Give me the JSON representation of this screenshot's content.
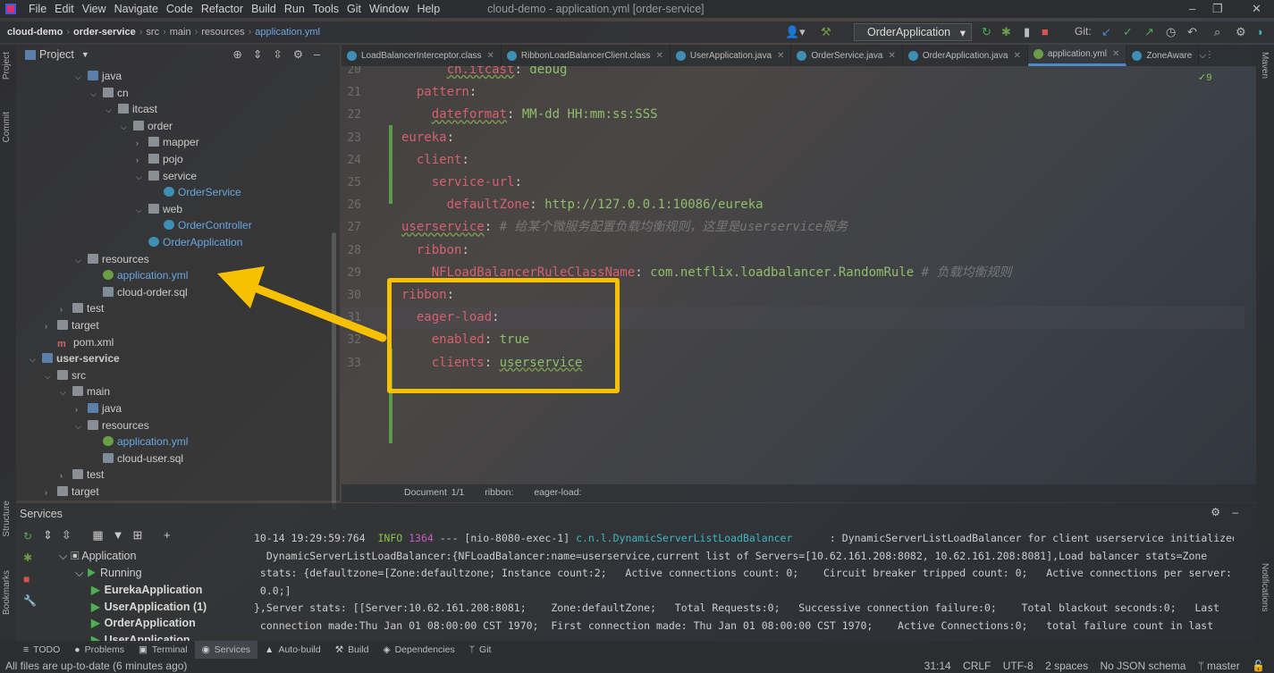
{
  "window": {
    "title": "cloud-demo - application.yml [order-service]",
    "menu": [
      "File",
      "Edit",
      "View",
      "Navigate",
      "Code",
      "Refactor",
      "Build",
      "Run",
      "Tools",
      "Git",
      "Window",
      "Help"
    ]
  },
  "breadcrumb": [
    "cloud-demo",
    "order-service",
    "src",
    "main",
    "resources",
    "application.yml"
  ],
  "toolbar": {
    "run_config": "OrderApplication",
    "git_label": "Git:"
  },
  "project": {
    "title": "Project",
    "tree": [
      {
        "label": "java",
        "depth": 4,
        "icon": "src",
        "open": true
      },
      {
        "label": "cn",
        "depth": 5,
        "icon": "folder",
        "open": true
      },
      {
        "label": "itcast",
        "depth": 6,
        "icon": "folder",
        "open": true
      },
      {
        "label": "order",
        "depth": 7,
        "icon": "folder",
        "open": true
      },
      {
        "label": "mapper",
        "depth": 8,
        "icon": "folder",
        "open": false
      },
      {
        "label": "pojo",
        "depth": 8,
        "icon": "folder",
        "open": false
      },
      {
        "label": "service",
        "depth": 8,
        "icon": "folder",
        "open": true
      },
      {
        "label": "OrderService",
        "depth": 9,
        "icon": "class",
        "leaf": true
      },
      {
        "label": "web",
        "depth": 8,
        "icon": "folder",
        "open": true
      },
      {
        "label": "OrderController",
        "depth": 9,
        "icon": "class",
        "leaf": true
      },
      {
        "label": "OrderApplication",
        "depth": 8,
        "icon": "class",
        "leaf": true
      },
      {
        "label": "resources",
        "depth": 4,
        "icon": "folder",
        "open": true
      },
      {
        "label": "application.yml",
        "depth": 5,
        "icon": "yml",
        "leaf": true,
        "selected": true
      },
      {
        "label": "cloud-order.sql",
        "depth": 5,
        "icon": "sql",
        "leaf": true
      },
      {
        "label": "test",
        "depth": 3,
        "icon": "folder",
        "open": false
      },
      {
        "label": "target",
        "depth": 2,
        "icon": "folder",
        "open": false
      },
      {
        "label": "pom.xml",
        "depth": 2,
        "icon": "mvn",
        "leaf": true
      },
      {
        "label": "user-service",
        "depth": 1,
        "icon": "mod",
        "open": true,
        "bold": true
      },
      {
        "label": "src",
        "depth": 2,
        "icon": "folder",
        "open": true
      },
      {
        "label": "main",
        "depth": 3,
        "icon": "folder",
        "open": true
      },
      {
        "label": "java",
        "depth": 4,
        "icon": "src",
        "open": false
      },
      {
        "label": "resources",
        "depth": 4,
        "icon": "folder",
        "open": true
      },
      {
        "label": "application.yml",
        "depth": 5,
        "icon": "yml",
        "leaf": true
      },
      {
        "label": "cloud-user.sql",
        "depth": 5,
        "icon": "sql",
        "leaf": true
      },
      {
        "label": "test",
        "depth": 3,
        "icon": "folder",
        "open": false
      },
      {
        "label": "target",
        "depth": 2,
        "icon": "folder",
        "open": false
      }
    ]
  },
  "tabs": [
    {
      "label": "LoadBalancerInterceptor.class"
    },
    {
      "label": "RibbonLoadBalancerClient.class"
    },
    {
      "label": "UserApplication.java"
    },
    {
      "label": "OrderService.java"
    },
    {
      "label": "OrderApplication.java"
    },
    {
      "label": "application.yml",
      "active": true
    },
    {
      "label": "ZoneAware"
    }
  ],
  "editor": {
    "inspections": "✓9",
    "cursor_line": 31,
    "lines": [
      {
        "n": 20,
        "t": [
          [
            "p",
            "      "
          ],
          [
            "k",
            "cn.itcast"
          ],
          [
            "p",
            ": "
          ],
          [
            "v",
            "debug"
          ]
        ]
      },
      {
        "n": 21,
        "t": [
          [
            "p",
            "  "
          ],
          [
            "k",
            "pattern"
          ],
          [
            "p",
            ":"
          ]
        ]
      },
      {
        "n": 22,
        "t": [
          [
            "p",
            "    "
          ],
          [
            "k",
            "dateformat"
          ],
          [
            "p",
            ": "
          ],
          [
            "v",
            "MM-dd HH:mm:ss:SSS"
          ]
        ]
      },
      {
        "n": 23,
        "t": [
          [
            "k",
            "eureka"
          ],
          [
            "p",
            ":"
          ]
        ]
      },
      {
        "n": 24,
        "t": [
          [
            "p",
            "  "
          ],
          [
            "k",
            "client"
          ],
          [
            "p",
            ":"
          ]
        ]
      },
      {
        "n": 25,
        "t": [
          [
            "p",
            "    "
          ],
          [
            "k",
            "service-url"
          ],
          [
            "p",
            ":"
          ]
        ]
      },
      {
        "n": 26,
        "t": [
          [
            "p",
            "      "
          ],
          [
            "k",
            "defaultZone"
          ],
          [
            "p",
            ": "
          ],
          [
            "v",
            "http://127.0.0.1:10086/eureka"
          ]
        ]
      },
      {
        "n": 27,
        "t": [
          [
            "k",
            "userservice"
          ],
          [
            "p",
            ": "
          ],
          [
            "c",
            "# 给某个微服务配置负载均衡规则，这里是userservice服务"
          ]
        ]
      },
      {
        "n": 28,
        "t": [
          [
            "p",
            "  "
          ],
          [
            "k",
            "ribbon"
          ],
          [
            "p",
            ":"
          ]
        ]
      },
      {
        "n": 29,
        "t": [
          [
            "p",
            "    "
          ],
          [
            "k",
            "NFLoadBalancerRuleClassName"
          ],
          [
            "p",
            ": "
          ],
          [
            "v",
            "com.netflix.loadbalancer.RandomRule"
          ],
          [
            "c",
            " # 负载均衡规则"
          ]
        ]
      },
      {
        "n": 30,
        "t": [
          [
            "k",
            "ribbon"
          ],
          [
            "p",
            ":"
          ]
        ]
      },
      {
        "n": 31,
        "t": [
          [
            "p",
            "  "
          ],
          [
            "k",
            "eager-load"
          ],
          [
            "p",
            ":"
          ]
        ]
      },
      {
        "n": 32,
        "t": [
          [
            "p",
            "    "
          ],
          [
            "k",
            "enabled"
          ],
          [
            "p",
            ": "
          ],
          [
            "v",
            "true"
          ]
        ]
      },
      {
        "n": 33,
        "t": [
          [
            "p",
            "    "
          ],
          [
            "k",
            "clients"
          ],
          [
            "p",
            ": "
          ],
          [
            "v",
            "userservice"
          ]
        ]
      }
    ]
  },
  "editor_breadcrumb": [
    "Document 1/1",
    "ribbon:",
    "eager-load:"
  ],
  "services": {
    "title": "Services",
    "tree": [
      {
        "label": "Application",
        "depth": 0
      },
      {
        "label": "Running",
        "depth": 1
      },
      {
        "label": "EurekaApplication",
        "depth": 2
      },
      {
        "label": "UserApplication (1)",
        "depth": 2
      },
      {
        "label": "OrderApplication",
        "depth": 2
      },
      {
        "label": "UserApplication",
        "depth": 2
      }
    ],
    "console": [
      [
        [
          "p",
          "10-14 19:29:59:764  "
        ],
        [
          "info",
          "INFO"
        ],
        [
          "pid",
          " 1364"
        ],
        [
          "p",
          " --- [nio-8080-exec-1] "
        ],
        [
          "logger",
          "c.n.l.DynamicServerListLoadBalancer"
        ],
        [
          "p",
          "      : DynamicServerListLoadBalancer for client userservice initialized:"
        ]
      ],
      [
        [
          "p",
          "  DynamicServerListLoadBalancer:{NFLoadBalancer:name=userservice,current list of Servers=[10.62.161.208:8082, 10.62.161.208:8081],Load balancer stats=Zone"
        ]
      ],
      [
        [
          "p",
          " stats: {defaultzone=[Zone:defaultzone; Instance count:2;   Active connections count: 0;    Circuit breaker tripped count: 0;   Active connections per server:"
        ]
      ],
      [
        [
          "p",
          " 0.0;]"
        ]
      ],
      [
        [
          "p",
          "},Server stats: [[Server:10.62.161.208:8081;    Zone:defaultZone;   Total Requests:0;   Successive connection failure:0;    Total blackout seconds:0;   Last"
        ]
      ],
      [
        [
          "p",
          " connection made:Thu Jan 01 08:00:00 CST 1970;  First connection made: Thu Jan 01 08:00:00 CST 1970;    Active Connections:0;   total failure count in last"
        ]
      ]
    ]
  },
  "bottom_tabs": [
    "TODO",
    "Problems",
    "Terminal",
    "Services",
    "Auto-build",
    "Build",
    "Dependencies",
    "Git"
  ],
  "active_bottom_tab": "Services",
  "side_labels": {
    "project": "Project",
    "commit": "Commit",
    "structure": "Structure",
    "bookmarks": "Bookmarks",
    "maven": "Maven",
    "notifications": "Notifications"
  },
  "status": {
    "message": "All files are up-to-date (6 minutes ago)",
    "position": "31:14",
    "line_sep": "CRLF",
    "encoding": "UTF-8",
    "indent": "2 spaces",
    "schema": "No JSON schema",
    "branch": "master"
  },
  "colors": {
    "highlight_box": "#f8c100",
    "yaml_key": "#d5616d",
    "yaml_value": "#8fbf6a",
    "accent": "#4a88c7"
  }
}
